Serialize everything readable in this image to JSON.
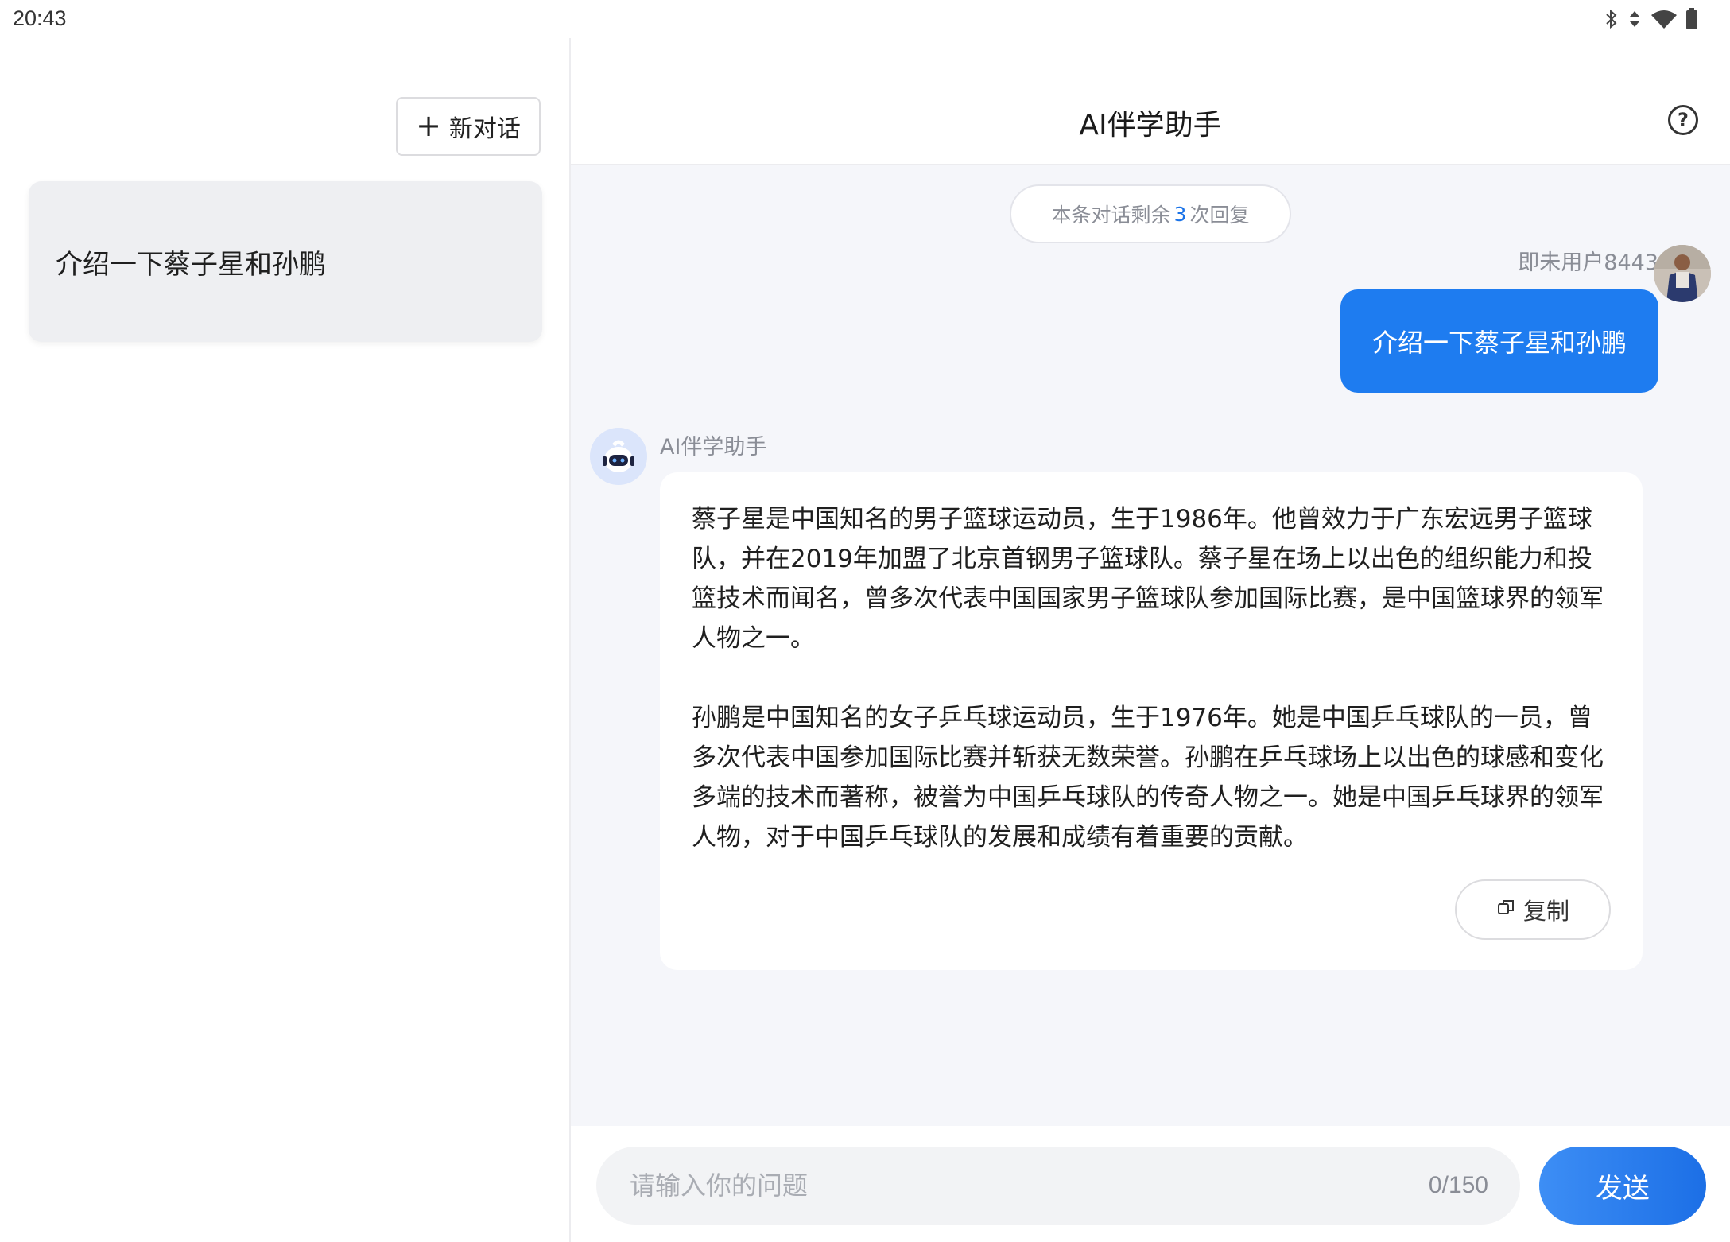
{
  "status_bar": {
    "time": "20:43",
    "icons": [
      "bluetooth-icon",
      "signal-icon",
      "wifi-icon",
      "battery-icon"
    ]
  },
  "sidebar": {
    "new_chat_label": "新对话",
    "history": [
      {
        "title": "介绍一下蔡子星和孙鹏"
      }
    ]
  },
  "header": {
    "title": "AI伴学助手",
    "help_icon": "help-icon"
  },
  "chat": {
    "remaining": {
      "prefix": "本条对话剩余",
      "count": "3",
      "suffix": "次回复"
    },
    "user": {
      "name": "即未用户8443",
      "message": "介绍一下蔡子星和孙鹏"
    },
    "bot": {
      "name": "AI伴学助手",
      "paragraphs": [
        "蔡子星是中国知名的男子篮球运动员，生于1986年。他曾效力于广东宏远男子篮球队，并在2019年加盟了北京首钢男子篮球队。蔡子星在场上以出色的组织能力和投篮技术而闻名，曾多次代表中国国家男子篮球队参加国际比赛，是中国篮球界的领军人物之一。",
        "孙鹏是中国知名的女子乒乓球运动员，生于1976年。她是中国乒乓球队的一员，曾多次代表中国参加国际比赛并斩获无数荣誉。孙鹏在乒乓球场上以出色的球感和变化多端的技术而著称，被誉为中国乒乓球队的传奇人物之一。她是中国乒乓球界的领军人物，对于中国乒乓球队的发展和成绩有着重要的贡献。"
      ],
      "copy_label": "复制"
    }
  },
  "input": {
    "placeholder": "请输入你的问题",
    "value": "",
    "char_count": "0/150",
    "send_label": "发送"
  },
  "colors": {
    "accent": "#1e7cf0",
    "count_highlight": "#1a73e8",
    "chat_background": "#f5f6fa"
  }
}
